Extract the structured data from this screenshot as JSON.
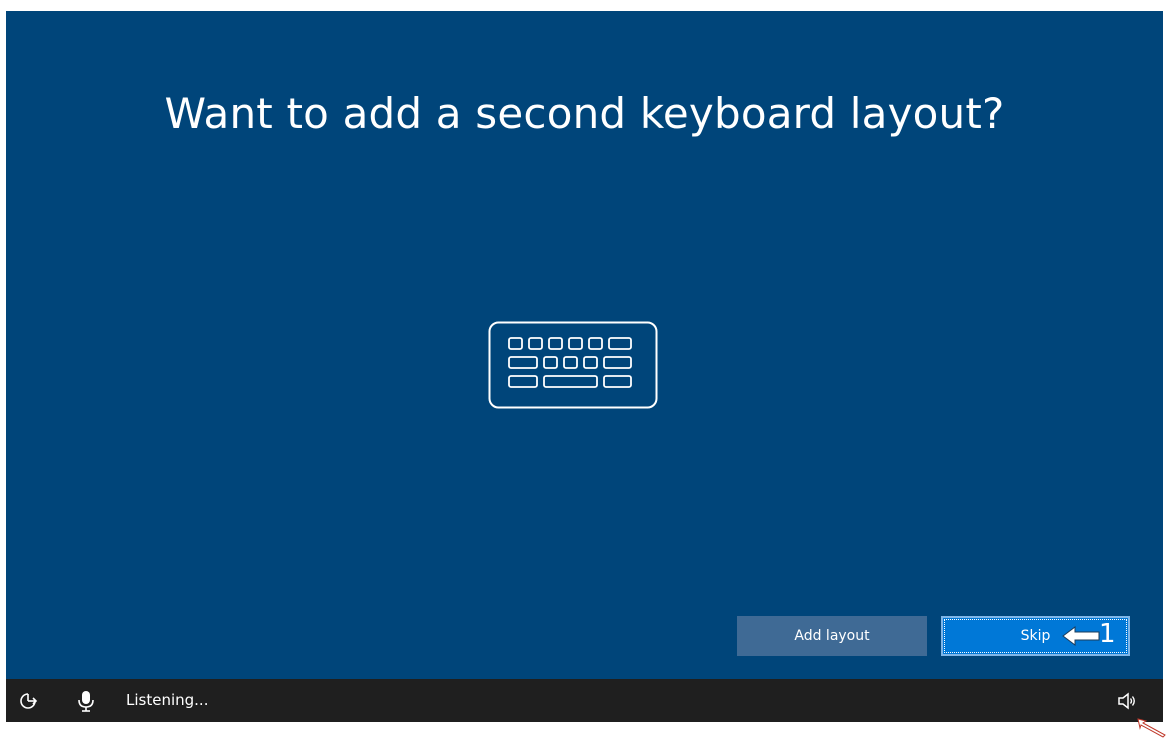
{
  "page": {
    "title": "Want to add a second keyboard layout?"
  },
  "icons": {
    "main": "keyboard-icon",
    "ease_of_access": "ease-of-access-icon",
    "microphone": "microphone-icon",
    "volume": "volume-icon"
  },
  "buttons": {
    "add_layout_label": "Add layout",
    "skip_label": "Skip"
  },
  "annotation": {
    "step_number": "1"
  },
  "taskbar": {
    "status_text": "Listening..."
  },
  "colors": {
    "background": "#00457a",
    "primary_button": "#0078d7",
    "secondary_button": "#3f6a95",
    "taskbar": "#1f1f1f"
  }
}
